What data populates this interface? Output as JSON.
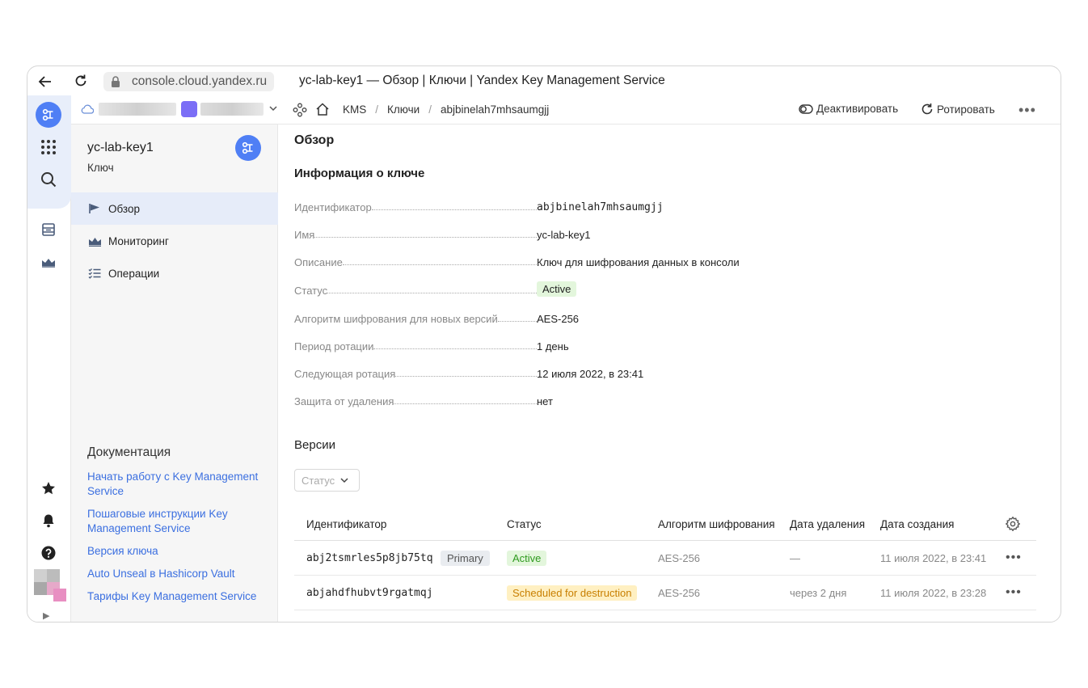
{
  "browser": {
    "url": "console.cloud.yandex.ru",
    "title": "yc-lab-key1 — Обзор | Ключи | Yandex Key Management Service"
  },
  "breadcrumbs": [
    "KMS",
    "Ключи",
    "abjbinelah7mhsaumgjj"
  ],
  "actions": {
    "deactivate": "Деактивировать",
    "rotate": "Ротировать",
    "more": "•••"
  },
  "sidebar": {
    "title": "yc-lab-key1",
    "subtitle": "Ключ",
    "items": [
      {
        "label": "Обзор",
        "icon": "flag-icon",
        "active": true
      },
      {
        "label": "Мониторинг",
        "icon": "chart-icon",
        "active": false
      },
      {
        "label": "Операции",
        "icon": "list-icon",
        "active": false
      }
    ],
    "docs_title": "Документация",
    "docs": [
      "Начать работу с Key Management Service",
      "Пошаговые инструкции Key Management Service",
      "Версия ключа",
      "Auto Unseal в Hashicorp Vault",
      "Тарифы Key Management Service"
    ]
  },
  "main": {
    "title": "Обзор",
    "info_title": "Информация о ключе",
    "info": [
      {
        "label": "Идентификатор",
        "value": "abjbinelah7mhsaumgjj",
        "type": "mono"
      },
      {
        "label": "Имя",
        "value": "yc-lab-key1",
        "type": "text"
      },
      {
        "label": "Описание",
        "value": "Ключ для шифрования данных в консоли",
        "type": "text"
      },
      {
        "label": "Статус",
        "value": "Active",
        "type": "badge"
      },
      {
        "label": "Алгоритм шифрования для новых версий",
        "value": "AES-256",
        "type": "text"
      },
      {
        "label": "Период ротации",
        "value": "1 день",
        "type": "text"
      },
      {
        "label": "Следующая ротация",
        "value": "12 июля 2022, в 23:41",
        "type": "text"
      },
      {
        "label": "Защита от удаления",
        "value": "нет",
        "type": "text"
      }
    ],
    "versions_title": "Версии",
    "status_filter_placeholder": "Статус",
    "columns": [
      "Идентификатор",
      "Статус",
      "Алгоритм шифрования",
      "Дата удаления",
      "Дата создания"
    ],
    "versions": [
      {
        "id": "abj2tsmrles5p8jb75tq",
        "tag": "Primary",
        "status": "Active",
        "status_color": "#2f9a1f",
        "algorithm": "AES-256",
        "deleted": "—",
        "created": "11 июля 2022, в 23:41"
      },
      {
        "id": "abjahdfhubvt9rgatmqj",
        "tag": "",
        "status": "Scheduled for destruction",
        "status_color": "#c87f00",
        "algorithm": "AES-256",
        "deleted": "через 2 дня",
        "created": "11 июля 2022, в 23:28"
      }
    ]
  },
  "colors": {
    "accent": "#4f7ff5",
    "link": "#3b6fe0",
    "active_nav": "#e6ecf9"
  }
}
